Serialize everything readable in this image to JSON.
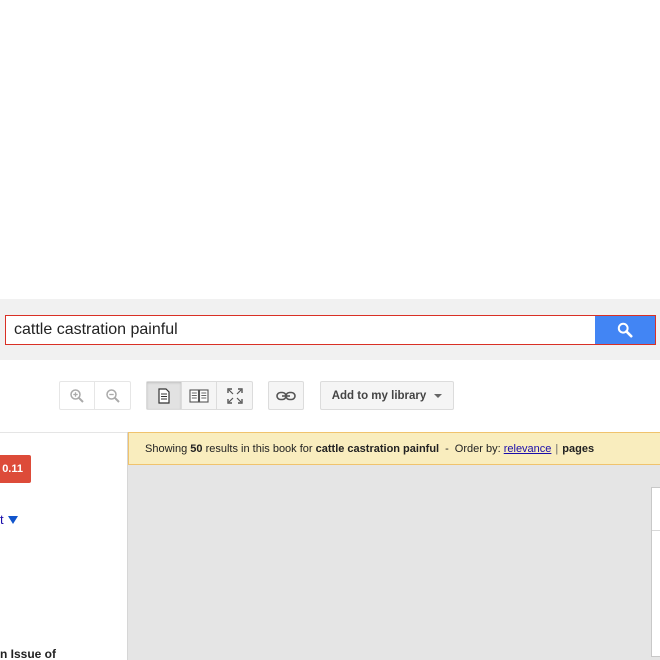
{
  "search": {
    "query": "cattle castration painful",
    "button_icon": "search-icon"
  },
  "toolbar": {
    "zoom_in_icon": "zoom-in-icon",
    "zoom_out_icon": "zoom-out-icon",
    "single_page_icon": "single-page-icon",
    "two_page_icon": "two-page-icon",
    "fullscreen_icon": "fullscreen-icon",
    "link_icon": "link-icon",
    "library_label": "Add to my library"
  },
  "sidebar": {
    "price_label": "0.11",
    "get_link_label": "t",
    "issue_text": "n Issue of"
  },
  "results": {
    "prefix": "Showing",
    "count": "50",
    "middle": "results in this book for",
    "query": "cattle castration painful",
    "dash": "-",
    "order_by_label": "Order by:",
    "relevance_label": "relevance",
    "pipe": "|",
    "pages_label": "pages"
  },
  "colors": {
    "search_button": "#4285f4",
    "search_border": "#d93025",
    "price_button": "#dd4b39",
    "results_bar": "#f9edbe",
    "link": "#1a0dab"
  }
}
